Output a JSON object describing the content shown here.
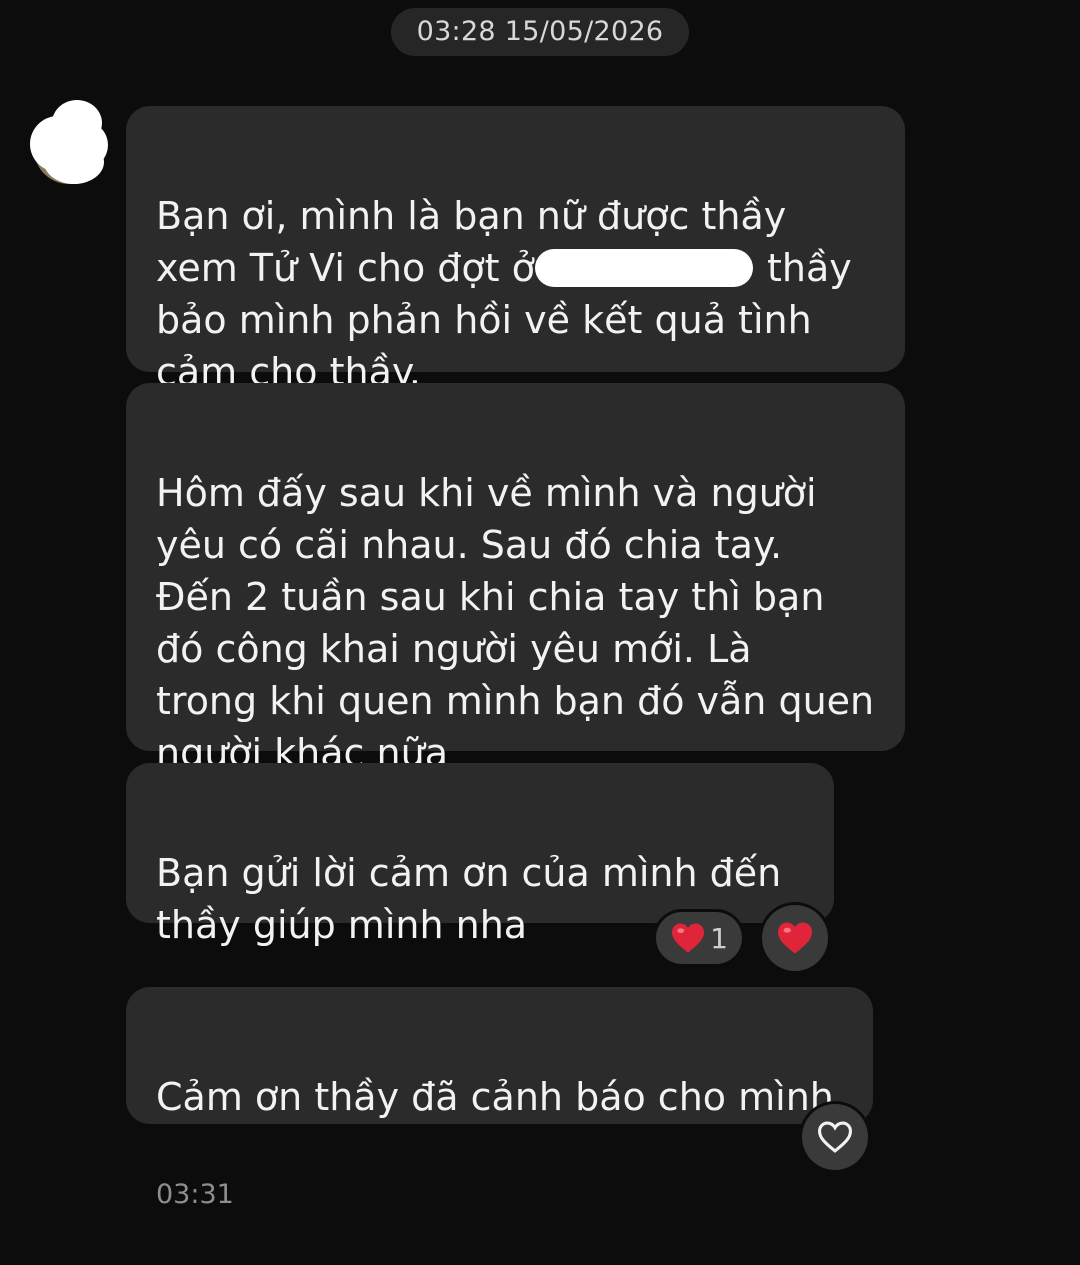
{
  "header": {
    "date_label": "03:28 15/05/2026"
  },
  "conversation": {
    "messages": [
      {
        "line1": "Bạn ơi, mình là bạn nữ được thầy",
        "line2_before": "xem Tử Vi cho đợt ở",
        "line2_after": " thầy",
        "rest": "bảo mình phản hồi về kết quả tình\ncảm cho thầy."
      },
      {
        "text": "Hôm đấy sau khi về mình và người\nyêu có cãi nhau. Sau đó chia tay.\nĐến 2 tuần sau khi chia tay thì bạn\nđó công khai người yêu mới. Là\ntrong khi quen mình bạn đó vẫn quen\nngười khác nữa"
      },
      {
        "text": "Bạn gửi lời cảm ơn của mình đến\nthầy giúp mình nha",
        "reaction_count": "1",
        "reaction_icon": "heart-icon"
      },
      {
        "text": "Cảm ơn thầy đã cảnh báo cho mình",
        "time": "03:31",
        "action_icon": "heart-outline-icon"
      }
    ]
  },
  "colors": {
    "background": "#0c0c0c",
    "bubble": "#2b2b2b",
    "heart": "#e0243a"
  }
}
